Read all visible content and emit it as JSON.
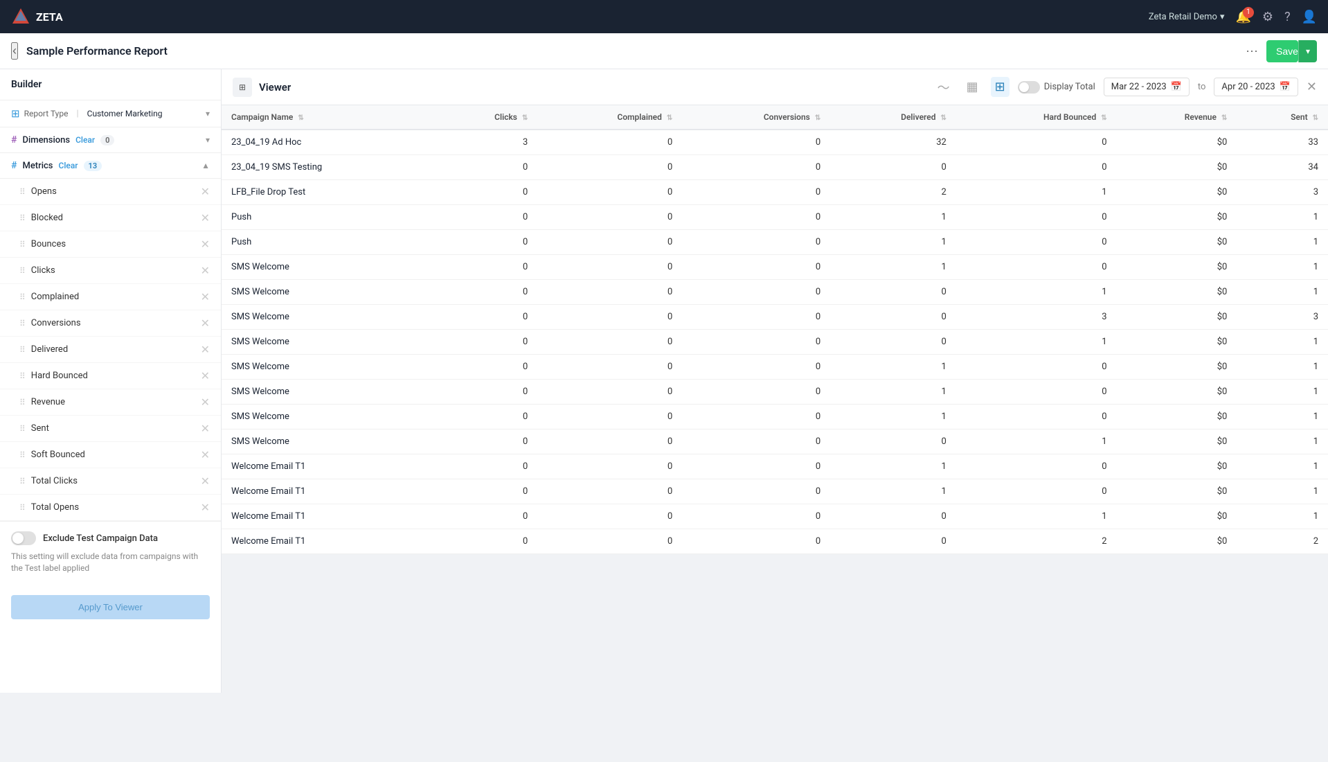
{
  "topNav": {
    "logo": "ZETA",
    "org": "Zeta Retail Demo",
    "orgChevron": "▾",
    "notifCount": "1",
    "icons": [
      "bell",
      "gear",
      "question",
      "user"
    ]
  },
  "subHeader": {
    "backLabel": "‹",
    "title": "Sample Performance Report",
    "moreLabel": "···",
    "saveLabel": "Save",
    "saveArrow": "▾"
  },
  "builder": {
    "title": "Builder",
    "reportTypeLabel": "Report Type",
    "reportTypeValue": "Customer Marketing",
    "dimensions": {
      "label": "Dimensions",
      "clearLabel": "Clear",
      "badgeCount": "0",
      "chevron": "▾"
    },
    "metrics": {
      "label": "Metrics",
      "clearLabel": "Clear",
      "badgeCount": "13",
      "chevron": "▾",
      "items": [
        "Opens",
        "Blocked",
        "Bounces",
        "Clicks",
        "Complained",
        "Conversions",
        "Delivered",
        "Hard Bounced",
        "Revenue",
        "Sent",
        "Soft Bounced",
        "Total Clicks",
        "Total Opens"
      ]
    },
    "exclude": {
      "label": "Exclude Test Campaign Data",
      "description": "This setting will exclude data from campaigns with the Test label applied"
    },
    "applyLabel": "Apply To Viewer"
  },
  "viewer": {
    "title": "Viewer",
    "displayTotalLabel": "Display Total",
    "dateFrom": "Mar 22 - 2023",
    "dateTo": "Apr 20 - 2023",
    "table": {
      "columns": [
        "Campaign Name",
        "Clicks",
        "Complained",
        "Conversions",
        "Delivered",
        "Hard Bounced",
        "Revenue",
        "Sent"
      ],
      "rows": [
        {
          "name": "23_04_19 Ad Hoc",
          "clicks": 3,
          "complained": 0,
          "conversions": 0,
          "delivered": 32,
          "hardBounced": 0,
          "revenue": "$0",
          "sent": 33
        },
        {
          "name": "23_04_19 SMS Testing",
          "clicks": 0,
          "complained": 0,
          "conversions": 0,
          "delivered": 0,
          "hardBounced": 0,
          "revenue": "$0",
          "sent": 34
        },
        {
          "name": "LFB_File Drop Test",
          "clicks": 0,
          "complained": 0,
          "conversions": 0,
          "delivered": 2,
          "hardBounced": 1,
          "revenue": "$0",
          "sent": 3
        },
        {
          "name": "Push",
          "clicks": 0,
          "complained": 0,
          "conversions": 0,
          "delivered": 1,
          "hardBounced": 0,
          "revenue": "$0",
          "sent": 1
        },
        {
          "name": "Push",
          "clicks": 0,
          "complained": 0,
          "conversions": 0,
          "delivered": 1,
          "hardBounced": 0,
          "revenue": "$0",
          "sent": 1
        },
        {
          "name": "SMS Welcome",
          "clicks": 0,
          "complained": 0,
          "conversions": 0,
          "delivered": 1,
          "hardBounced": 0,
          "revenue": "$0",
          "sent": 1
        },
        {
          "name": "SMS Welcome",
          "clicks": 0,
          "complained": 0,
          "conversions": 0,
          "delivered": 0,
          "hardBounced": 1,
          "revenue": "$0",
          "sent": 1
        },
        {
          "name": "SMS Welcome",
          "clicks": 0,
          "complained": 0,
          "conversions": 0,
          "delivered": 0,
          "hardBounced": 3,
          "revenue": "$0",
          "sent": 3
        },
        {
          "name": "SMS Welcome",
          "clicks": 0,
          "complained": 0,
          "conversions": 0,
          "delivered": 0,
          "hardBounced": 1,
          "revenue": "$0",
          "sent": 1
        },
        {
          "name": "SMS Welcome",
          "clicks": 0,
          "complained": 0,
          "conversions": 0,
          "delivered": 1,
          "hardBounced": 0,
          "revenue": "$0",
          "sent": 1
        },
        {
          "name": "SMS Welcome",
          "clicks": 0,
          "complained": 0,
          "conversions": 0,
          "delivered": 1,
          "hardBounced": 0,
          "revenue": "$0",
          "sent": 1
        },
        {
          "name": "SMS Welcome",
          "clicks": 0,
          "complained": 0,
          "conversions": 0,
          "delivered": 1,
          "hardBounced": 0,
          "revenue": "$0",
          "sent": 1
        },
        {
          "name": "SMS Welcome",
          "clicks": 0,
          "complained": 0,
          "conversions": 0,
          "delivered": 0,
          "hardBounced": 1,
          "revenue": "$0",
          "sent": 1
        },
        {
          "name": "Welcome Email T1",
          "clicks": 0,
          "complained": 0,
          "conversions": 0,
          "delivered": 1,
          "hardBounced": 0,
          "revenue": "$0",
          "sent": 1
        },
        {
          "name": "Welcome Email T1",
          "clicks": 0,
          "complained": 0,
          "conversions": 0,
          "delivered": 1,
          "hardBounced": 0,
          "revenue": "$0",
          "sent": 1
        },
        {
          "name": "Welcome Email T1",
          "clicks": 0,
          "complained": 0,
          "conversions": 0,
          "delivered": 0,
          "hardBounced": 1,
          "revenue": "$0",
          "sent": 1
        },
        {
          "name": "Welcome Email T1",
          "clicks": 0,
          "complained": 0,
          "conversions": 0,
          "delivered": 0,
          "hardBounced": 2,
          "revenue": "$0",
          "sent": 2
        }
      ]
    }
  }
}
